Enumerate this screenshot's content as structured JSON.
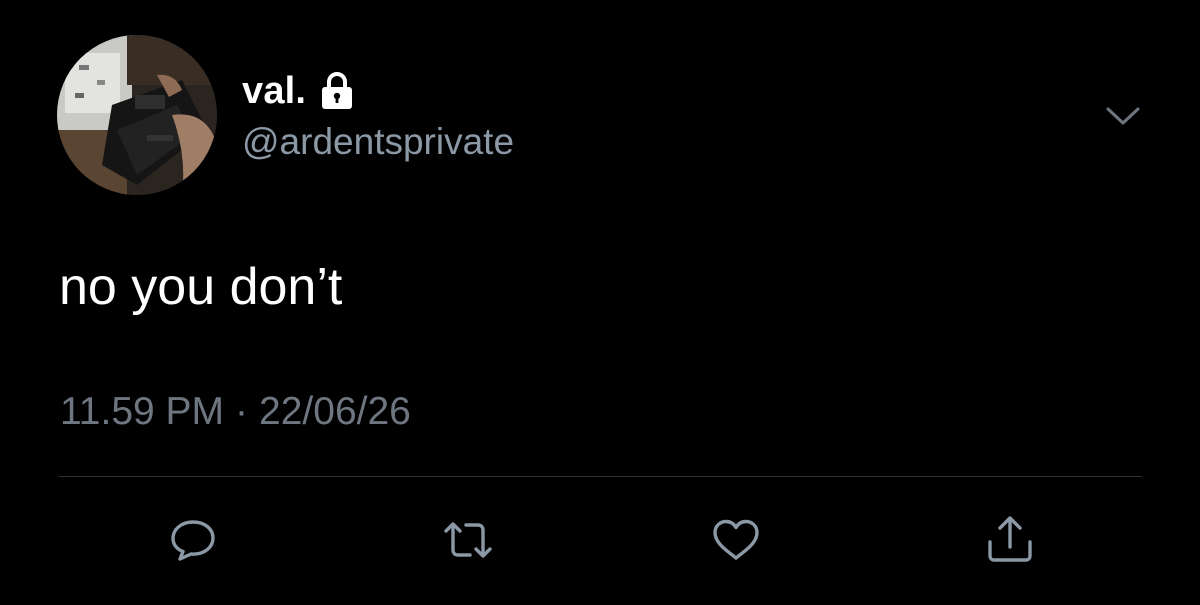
{
  "tweet": {
    "display_name": "val.",
    "handle": "@ardentsprivate",
    "protected_icon": "lock-icon",
    "text": "no you don’t",
    "time": "11.59 PM",
    "separator": "·",
    "date": "22/06/26"
  },
  "actions": [
    {
      "name": "reply",
      "icon": "speech-bubble-icon"
    },
    {
      "name": "retweet",
      "icon": "retweet-icon"
    },
    {
      "name": "like",
      "icon": "heart-icon"
    },
    {
      "name": "share",
      "icon": "share-icon"
    }
  ],
  "colors": {
    "background": "#000000",
    "primary_text": "#ffffff",
    "secondary_text": "#8b98a5",
    "muted_text": "#6e7781",
    "icon": "#8b98a5",
    "divider": "#2f3336"
  }
}
